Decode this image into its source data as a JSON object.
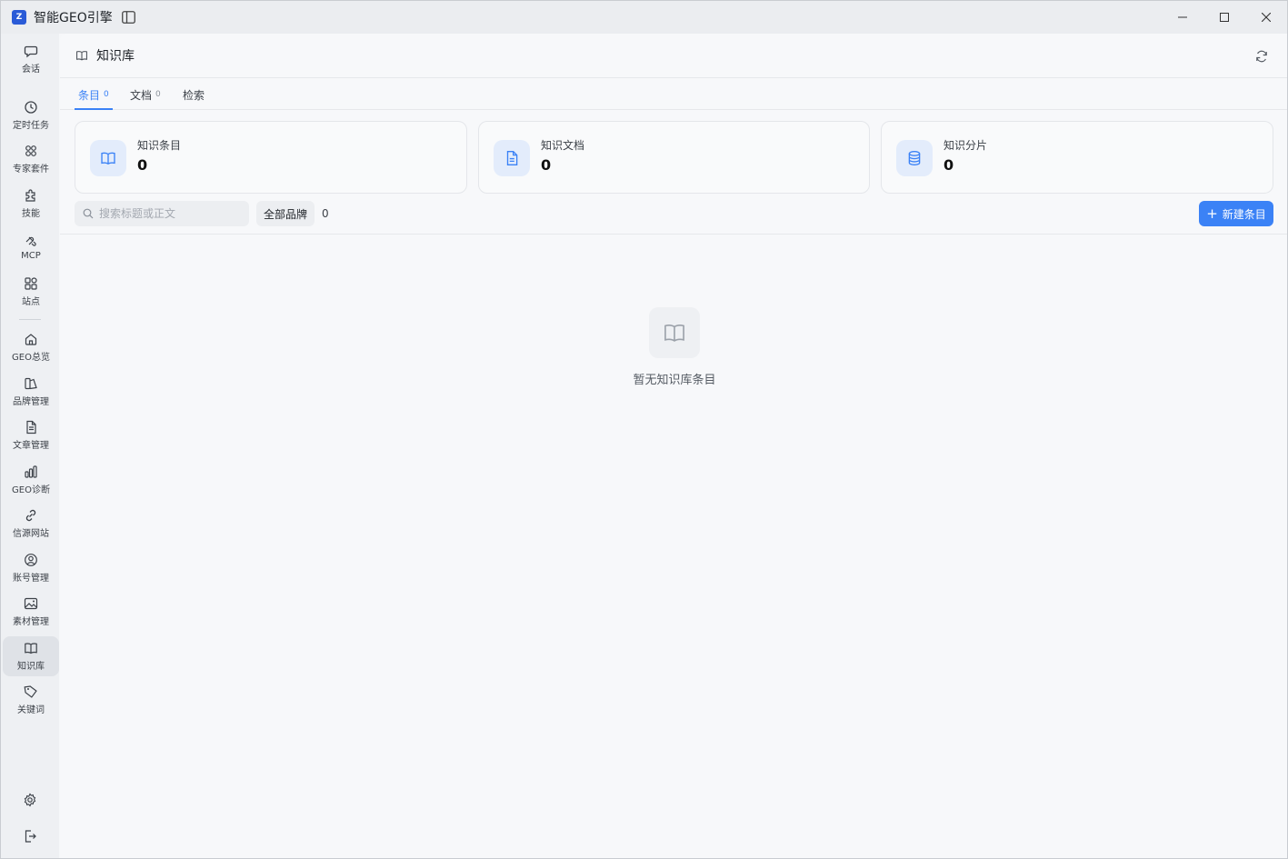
{
  "window": {
    "title": "智能GEO引擎",
    "logo_text": "Z",
    "controls": {
      "minimize": "─",
      "maximize": "□",
      "close": "✕"
    }
  },
  "nav": {
    "items": [
      {
        "label": "会话",
        "icon": "chat-icon"
      },
      {
        "label": "定时任务",
        "icon": "clock-icon"
      },
      {
        "label": "专家套件",
        "icon": "apps-icon"
      },
      {
        "label": "技能",
        "icon": "puzzle-icon"
      },
      {
        "label": "MCP",
        "icon": "mcp-icon"
      },
      {
        "label": "站点",
        "icon": "grid-icon"
      },
      {
        "label": "GEO总览",
        "icon": "home-icon"
      },
      {
        "label": "品牌管理",
        "icon": "brand-icon"
      },
      {
        "label": "文章管理",
        "icon": "document-icon"
      },
      {
        "label": "GEO诊断",
        "icon": "bar-chart-icon"
      },
      {
        "label": "信源网站",
        "icon": "link-icon"
      },
      {
        "label": "账号管理",
        "icon": "user-circle-icon"
      },
      {
        "label": "素材管理",
        "icon": "image-icon"
      },
      {
        "label": "知识库",
        "icon": "book-icon"
      },
      {
        "label": "关键词",
        "icon": "tag-icon"
      }
    ],
    "active": "知识库",
    "bottom": [
      {
        "icon": "settings-icon"
      },
      {
        "icon": "logout-icon"
      }
    ]
  },
  "header": {
    "title": "知识库",
    "icon": "book-icon",
    "refresh_icon": "refresh-icon"
  },
  "tabs": [
    {
      "label": "条目",
      "count": "0",
      "active": true
    },
    {
      "label": "文档",
      "count": "0",
      "active": false
    },
    {
      "label": "检索",
      "count": "",
      "active": false
    }
  ],
  "stats": [
    {
      "label": "知识条目",
      "value": "0",
      "icon": "book-icon"
    },
    {
      "label": "知识文档",
      "value": "0",
      "icon": "file-text-icon"
    },
    {
      "label": "知识分片",
      "value": "0",
      "icon": "database-icon"
    }
  ],
  "toolbar": {
    "search_placeholder": "搜索标题或正文",
    "search_value": "",
    "brand_filter": "全部品牌",
    "count": "0",
    "new_button": "新建条目",
    "new_button_icon": "+"
  },
  "empty": {
    "text": "暂无知识库条目",
    "icon": "book-icon"
  },
  "colors": {
    "accent": "#3b82f6",
    "card_icon_bg": "#e3ecfb"
  }
}
